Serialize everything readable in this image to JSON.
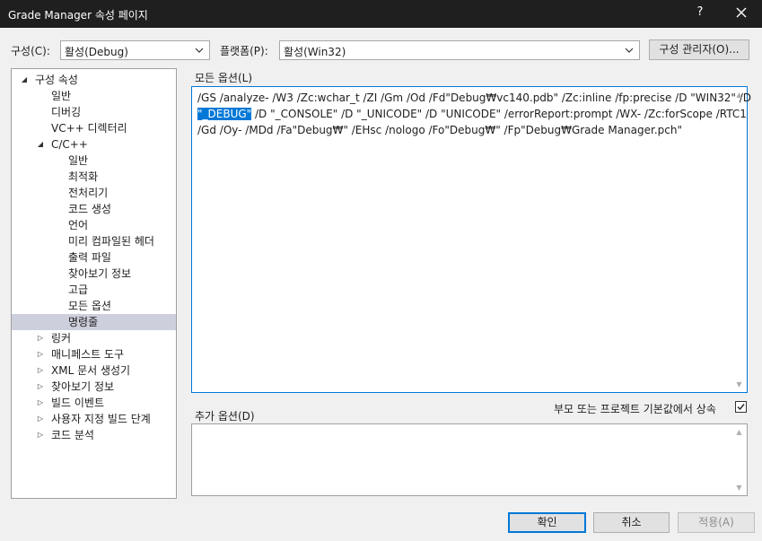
{
  "window": {
    "title": "Grade Manager 속성 페이지",
    "help": "?"
  },
  "top": {
    "config_label": "구성(C):",
    "config_value": "활성(Debug)",
    "platform_label": "플랫폼(P):",
    "platform_value": "활성(Win32)",
    "config_manager": "구성 관리자(O)..."
  },
  "tree": [
    {
      "label": "구성 속성",
      "expander": "◢",
      "level": 0
    },
    {
      "label": "일반",
      "level": 1
    },
    {
      "label": "디버깅",
      "level": 1
    },
    {
      "label": "VC++ 디렉터리",
      "level": 1
    },
    {
      "label": "C/C++",
      "expander": "◢",
      "level": 1
    },
    {
      "label": "일반",
      "level": 2
    },
    {
      "label": "최적화",
      "level": 2
    },
    {
      "label": "전처리기",
      "level": 2
    },
    {
      "label": "코드 생성",
      "level": 2
    },
    {
      "label": "언어",
      "level": 2
    },
    {
      "label": "미리 컴파일된 헤더",
      "level": 2
    },
    {
      "label": "출력 파일",
      "level": 2
    },
    {
      "label": "찾아보기 정보",
      "level": 2
    },
    {
      "label": "고급",
      "level": 2
    },
    {
      "label": "모든 옵션",
      "level": 2
    },
    {
      "label": "명령줄",
      "level": 2,
      "selected": true
    },
    {
      "label": "링커",
      "expander": "▷",
      "level": 1
    },
    {
      "label": "매니페스트 도구",
      "expander": "▷",
      "level": 1
    },
    {
      "label": "XML 문서 생성기",
      "expander": "▷",
      "level": 1
    },
    {
      "label": "찾아보기 정보",
      "expander": "▷",
      "level": 1
    },
    {
      "label": "빌드 이벤트",
      "expander": "▷",
      "level": 1
    },
    {
      "label": "사용자 지정 빌드 단계",
      "expander": "▷",
      "level": 1
    },
    {
      "label": "코드 분석",
      "expander": "▷",
      "level": 1
    }
  ],
  "all_options": {
    "label": "모든 옵션(L)",
    "line1": "/GS /analyze- /W3 /Zc:wchar_t /ZI /Gm /Od /Fd\"Debug₩vc140.pdb\" /Zc:inline /fp:precise /D \"WIN32\" /D",
    "line2_selected": "\"_DEBUG\"",
    "line2_rest": " /D \"_CONSOLE\" /D \"_UNICODE\" /D \"UNICODE\" /errorReport:prompt /WX- /Zc:forScope /RTC1",
    "line3": "/Gd /Oy- /MDd /Fa\"Debug₩\" /EHsc /nologo /Fo\"Debug₩\" /Fp\"Debug₩Grade Manager.pch\""
  },
  "additional_options": {
    "label": "추가 옵션(D)",
    "value": ""
  },
  "inherit": {
    "label": "부모 또는 프로젝트 기본값에서 상속",
    "checked": true
  },
  "buttons": {
    "ok": "확인",
    "cancel": "취소",
    "apply": "적용(A)"
  }
}
